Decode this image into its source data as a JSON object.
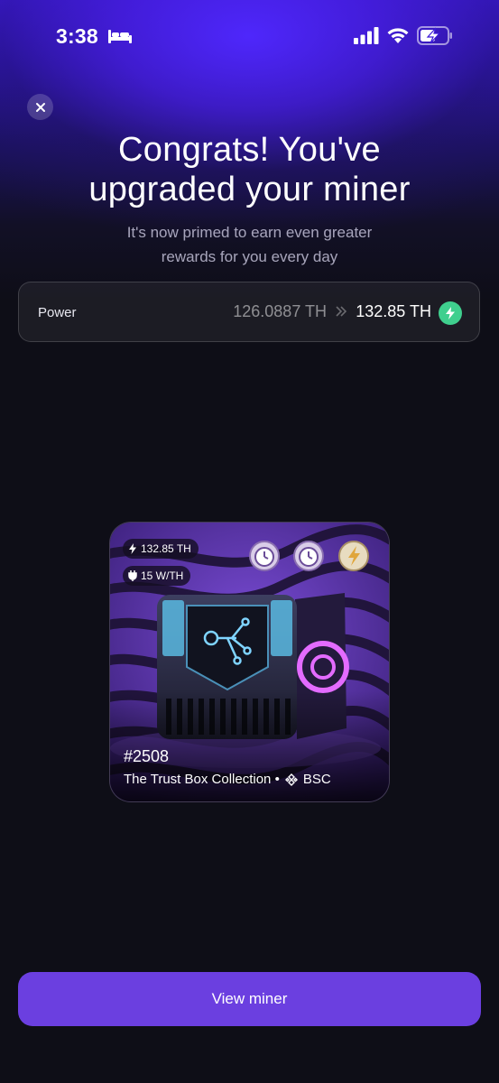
{
  "status_bar": {
    "time": "3:38",
    "icons": [
      "bed-icon",
      "signal-icon",
      "wifi-icon",
      "battery-charging-icon"
    ]
  },
  "header": {
    "close_icon": "close-icon",
    "title": "Congrats! You've upgraded your miner",
    "subtitle": "It's now primed to earn even greater rewards for you every day"
  },
  "power": {
    "label": "Power",
    "old_value": "126.0887 TH",
    "new_value": "132.85 TH",
    "arrow_icon": "double-chevron-right-icon",
    "bolt_icon": "lightning-bolt-icon",
    "accent_color": "#3fcf8e"
  },
  "miner": {
    "power_badge": "132.85 TH",
    "efficiency_badge": "15 W/TH",
    "boosts": [
      "stopwatch-icon",
      "stopwatch-icon",
      "lightning-coin-icon"
    ],
    "id": "#2508",
    "collection": "The Trust Box Collection •",
    "chain": "BSC",
    "chain_icon": "bnb-icon"
  },
  "footer": {
    "button_label": "View miner",
    "button_color": "#6b3fe0"
  }
}
